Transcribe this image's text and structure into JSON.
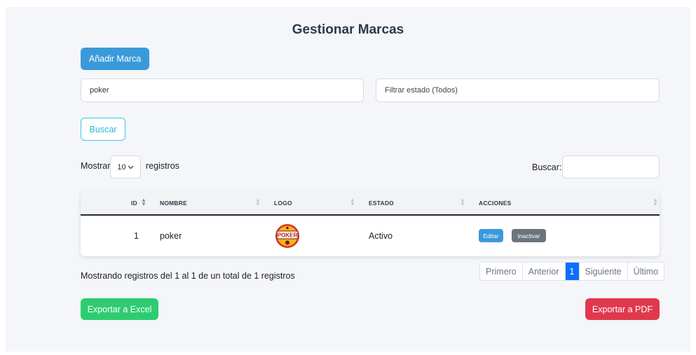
{
  "page": {
    "title": "Gestionar Marcas"
  },
  "toolbar": {
    "add_label": "Añadir Marca",
    "search_value": "poker",
    "filter_label": "Filtrar estado (Todos)",
    "buscar_label": "Buscar"
  },
  "table_controls": {
    "show_label": "Mostrar",
    "page_length": "10",
    "records_label": "registros",
    "search_label": "Buscar:"
  },
  "table": {
    "columns": [
      "ID",
      "NOMBRE",
      "LOGO",
      "ESTADO",
      "ACCIONES"
    ],
    "rows": [
      {
        "id": "1",
        "nombre": "poker",
        "logo_text": "POKER",
        "estado": "Activo",
        "edit_label": "Editar",
        "deactivate_label": "Inactivar"
      }
    ]
  },
  "info_text": "Mostrando registros del 1 al 1 de un total de 1 registros",
  "pagination": {
    "first": "Primero",
    "prev": "Anterior",
    "current": "1",
    "next": "Siguiente",
    "last": "Último"
  },
  "exports": {
    "excel": "Exportar a Excel",
    "pdf": "Exportar a PDF"
  },
  "colors": {
    "primary": "#3a9ad9",
    "info": "#29b7d9",
    "success": "#2ecc71",
    "danger": "#e0394d",
    "secondary": "#6c757d",
    "page_active": "#0d6efd"
  },
  "icons": [
    "chevron-down-icon",
    "sort-icon",
    "poker-logo"
  ]
}
